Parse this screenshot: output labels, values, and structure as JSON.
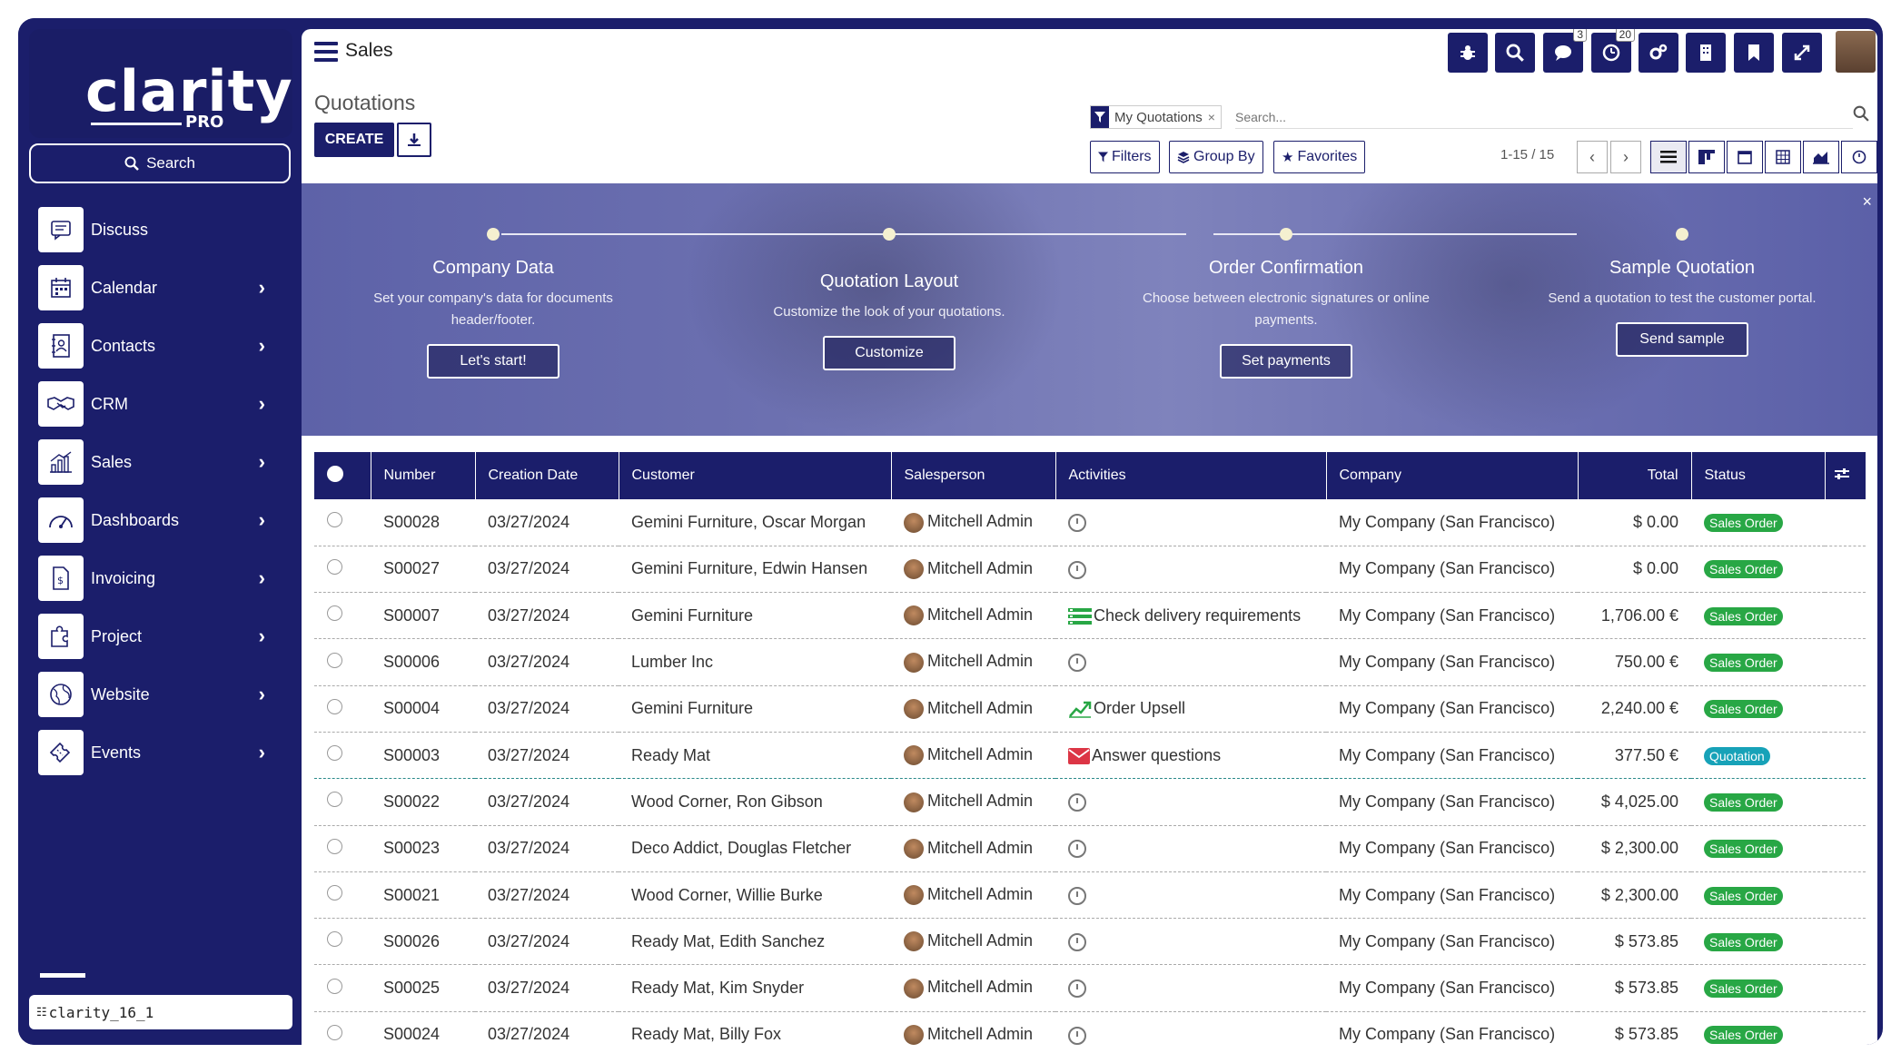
{
  "sidebar": {
    "logo": "clarity",
    "logo_sub": "PRO",
    "search_label": "Search",
    "items": [
      {
        "label": "Discuss",
        "icon": "discuss-icon",
        "arrow": ""
      },
      {
        "label": "Calendar",
        "icon": "calendar-icon",
        "arrow": "›"
      },
      {
        "label": "Contacts",
        "icon": "contacts-icon",
        "arrow": "›"
      },
      {
        "label": "CRM",
        "icon": "handshake-icon",
        "arrow": "›"
      },
      {
        "label": "Sales",
        "icon": "chart-icon",
        "arrow": "›"
      },
      {
        "label": "Dashboards",
        "icon": "gauge-icon",
        "arrow": "›"
      },
      {
        "label": "Invoicing",
        "icon": "invoice-icon",
        "arrow": "›"
      },
      {
        "label": "Project",
        "icon": "puzzle-icon",
        "arrow": "›"
      },
      {
        "label": "Website",
        "icon": "globe-icon",
        "arrow": "›"
      },
      {
        "label": "Events",
        "icon": "ticket-icon",
        "arrow": "›"
      }
    ],
    "database": "clarity_16_1"
  },
  "topbar": {
    "app_title": "Sales",
    "badges": {
      "chat": "3",
      "activity": "20"
    }
  },
  "control": {
    "breadcrumb": "Quotations",
    "create_label": "CREATE",
    "facet_label": "My Quotations",
    "facet_close": "×",
    "search_placeholder": "Search...",
    "filters_label": "Filters",
    "groupby_label": "Group By",
    "favorites_label": "Favorites",
    "pager": "1-15 / 15"
  },
  "banner": {
    "steps": [
      {
        "title": "Company Data",
        "desc": "Set your company's data for documents header/footer.",
        "button": "Let's start!"
      },
      {
        "title": "Quotation Layout",
        "desc": "Customize the look of your quotations.",
        "button": "Customize"
      },
      {
        "title": "Order Confirmation",
        "desc": "Choose between electronic signatures or online payments.",
        "button": "Set payments"
      },
      {
        "title": "Sample Quotation",
        "desc": "Send a quotation to test the customer portal.",
        "button": "Send sample"
      }
    ],
    "close": "×"
  },
  "table": {
    "headers": {
      "number": "Number",
      "date": "Creation Date",
      "customer": "Customer",
      "salesperson": "Salesperson",
      "activities": "Activities",
      "company": "Company",
      "total": "Total",
      "status": "Status"
    },
    "rows": [
      {
        "number": "S00028",
        "date": "03/27/2024",
        "customer": "Gemini Furniture, Oscar Morgan",
        "salesperson": "Mitchell Admin",
        "activity_type": "clock",
        "activity": "",
        "company": "My Company (San Francisco)",
        "total": "$ 0.00",
        "status": "Sales Order"
      },
      {
        "number": "S00027",
        "date": "03/27/2024",
        "customer": "Gemini Furniture, Edwin Hansen",
        "salesperson": "Mitchell Admin",
        "activity_type": "clock",
        "activity": "",
        "company": "My Company (San Francisco)",
        "total": "$ 0.00",
        "status": "Sales Order"
      },
      {
        "number": "S00007",
        "date": "03/27/2024",
        "customer": "Gemini Furniture",
        "salesperson": "Mitchell Admin",
        "activity_type": "todo",
        "activity": "Check delivery requirements",
        "company": "My Company (San Francisco)",
        "total": "1,706.00 €",
        "status": "Sales Order"
      },
      {
        "number": "S00006",
        "date": "03/27/2024",
        "customer": "Lumber Inc",
        "salesperson": "Mitchell Admin",
        "activity_type": "clock",
        "activity": "",
        "company": "My Company (San Francisco)",
        "total": "750.00 €",
        "status": "Sales Order"
      },
      {
        "number": "S00004",
        "date": "03/27/2024",
        "customer": "Gemini Furniture",
        "salesperson": "Mitchell Admin",
        "activity_type": "upsell",
        "activity": "Order Upsell",
        "company": "My Company (San Francisco)",
        "total": "2,240.00 €",
        "status": "Sales Order"
      },
      {
        "number": "S00003",
        "date": "03/27/2024",
        "customer": "Ready Mat",
        "salesperson": "Mitchell Admin",
        "activity_type": "email",
        "activity": "Answer questions",
        "company": "My Company (San Francisco)",
        "total": "377.50 €",
        "status": "Quotation"
      },
      {
        "number": "S00022",
        "date": "03/27/2024",
        "customer": "Wood Corner, Ron Gibson",
        "salesperson": "Mitchell Admin",
        "activity_type": "clock",
        "activity": "",
        "company": "My Company (San Francisco)",
        "total": "$ 4,025.00",
        "status": "Sales Order"
      },
      {
        "number": "S00023",
        "date": "03/27/2024",
        "customer": "Deco Addict, Douglas Fletcher",
        "salesperson": "Mitchell Admin",
        "activity_type": "clock",
        "activity": "",
        "company": "My Company (San Francisco)",
        "total": "$ 2,300.00",
        "status": "Sales Order"
      },
      {
        "number": "S00021",
        "date": "03/27/2024",
        "customer": "Wood Corner, Willie Burke",
        "salesperson": "Mitchell Admin",
        "activity_type": "clock",
        "activity": "",
        "company": "My Company (San Francisco)",
        "total": "$ 2,300.00",
        "status": "Sales Order"
      },
      {
        "number": "S00026",
        "date": "03/27/2024",
        "customer": "Ready Mat, Edith Sanchez",
        "salesperson": "Mitchell Admin",
        "activity_type": "clock",
        "activity": "",
        "company": "My Company (San Francisco)",
        "total": "$ 573.85",
        "status": "Sales Order"
      },
      {
        "number": "S00025",
        "date": "03/27/2024",
        "customer": "Ready Mat, Kim Snyder",
        "salesperson": "Mitchell Admin",
        "activity_type": "clock",
        "activity": "",
        "company": "My Company (San Francisco)",
        "total": "$ 573.85",
        "status": "Sales Order"
      },
      {
        "number": "S00024",
        "date": "03/27/2024",
        "customer": "Ready Mat, Billy Fox",
        "salesperson": "Mitchell Admin",
        "activity_type": "clock",
        "activity": "",
        "company": "My Company (San Francisco)",
        "total": "$ 573.85",
        "status": "Sales Order"
      }
    ]
  },
  "colors": {
    "brand": "#1b1e6b",
    "sales_order": "#28a745",
    "quotation": "#17a2b8"
  }
}
